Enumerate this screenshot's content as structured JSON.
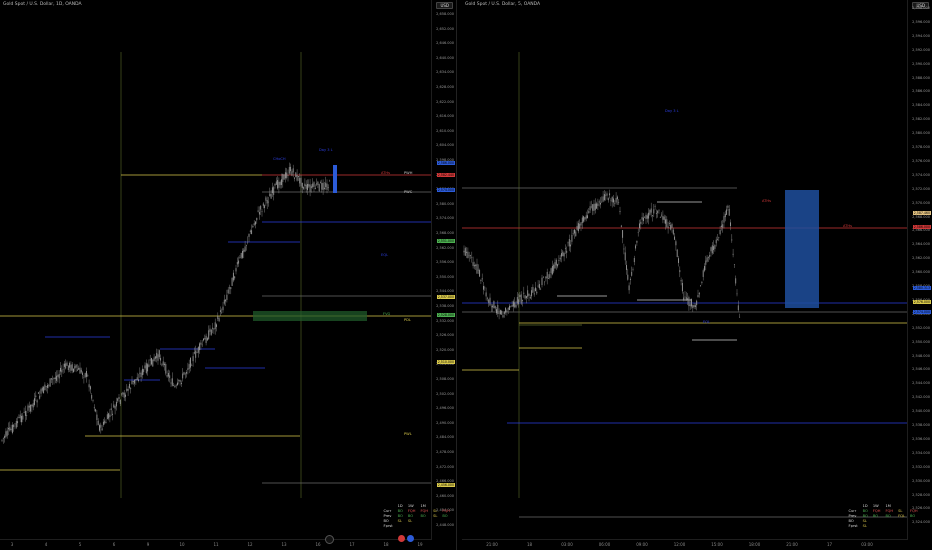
{
  "colors": {
    "background": "#000000",
    "candle": "#9a9a9a",
    "yellow_line": "#d8c84a",
    "olive_line": "#5b6b2b",
    "red_line": "#d03838",
    "blue_line": "#2c3ee0",
    "gray_line": "#888888",
    "green_zone": "#1f5a2a",
    "blue_box": "#1e4f9e"
  },
  "left": {
    "title": "Gold Spot / U.S. Dollar, 1D, OANDA",
    "currency": "USD",
    "price_ticks": [
      "2,658.000",
      "2,652.000",
      "2,646.000",
      "2,640.000",
      "2,634.000",
      "2,628.000",
      "2,622.000",
      "2,616.000",
      "2,610.000",
      "2,604.000",
      "2,598.000",
      "2,592.000",
      "2,586.000",
      "2,580.000",
      "2,574.000",
      "2,568.000",
      "2,562.000",
      "2,556.000",
      "2,550.000",
      "2,544.000",
      "2,538.000",
      "2,532.000",
      "2,526.000",
      "2,520.000",
      "2,514.000",
      "2,508.000",
      "2,502.000",
      "2,496.000",
      "2,490.000",
      "2,484.000",
      "2,478.000",
      "2,472.000",
      "2,466.000",
      "2,460.000",
      "2,454.000",
      "2,448.000"
    ],
    "time_ticks": [
      "3",
      "4",
      "5",
      "6",
      "9",
      "10",
      "11",
      "12",
      "13",
      "16",
      "17",
      "18",
      "19"
    ],
    "chart_labels": [
      {
        "text": "CHoCH",
        "color": "#2c3ee0"
      },
      {
        "text": "Day 3 L",
        "color": "#2c3ee0"
      },
      {
        "text": "ATHs",
        "color": "#d03838"
      },
      {
        "text": "PWH",
        "color": "#cccccc"
      },
      {
        "text": "PWC",
        "color": "#cccccc"
      },
      {
        "text": "PDL",
        "color": "#d8c84a"
      },
      {
        "text": "FVG",
        "color": "#4caf50"
      },
      {
        "text": "EQL",
        "color": "#2c3ee0"
      },
      {
        "text": "PWL",
        "color": "#d8c84a"
      }
    ],
    "price_tags": [
      {
        "text": "2,586.000",
        "bg": "#2c5bd8"
      },
      {
        "text": "2,582.440",
        "bg": "#d03838"
      },
      {
        "text": "2,574.000",
        "bg": "#2c5bd8"
      },
      {
        "text": "2,551.000",
        "bg": "#4caf50"
      },
      {
        "text": "2,537.000",
        "bg": "#d8c84a"
      },
      {
        "text": "2,528.000",
        "bg": "#4caf50"
      },
      {
        "text": "2,510.000",
        "bg": "#d8c84a"
      },
      {
        "text": "2,456.000",
        "bg": "#d8c84a"
      }
    ],
    "info_panel": {
      "headers": [
        "1D",
        "1W",
        "1M"
      ],
      "rows": [
        {
          "label": "Curr",
          "cells": [
            "BO",
            "FQH",
            "FQH",
            "SL",
            "FQH"
          ]
        },
        {
          "label": "Prev",
          "cells": [
            "BO",
            "BO",
            "BO",
            "SL",
            "BO"
          ]
        },
        {
          "label": "BO",
          "cells": [
            "SL",
            "SL",
            "",
            "",
            ""
          ]
        },
        {
          "label": "Fprst",
          "cells": [
            "",
            "",
            "",
            "",
            ""
          ]
        }
      ]
    }
  },
  "right": {
    "title": "Gold Spot / U.S. Dollar, 5, OANDA",
    "currency": "USD",
    "price_ticks": [
      "2,598.000",
      "2,596.000",
      "2,594.000",
      "2,592.000",
      "2,590.000",
      "2,588.000",
      "2,586.000",
      "2,584.000",
      "2,582.000",
      "2,580.000",
      "2,578.000",
      "2,576.000",
      "2,574.000",
      "2,572.000",
      "2,570.000",
      "2,568.000",
      "2,566.000",
      "2,564.000",
      "2,562.000",
      "2,560.000",
      "2,558.000",
      "2,556.000",
      "2,554.000",
      "2,552.000",
      "2,550.000",
      "2,548.000",
      "2,546.000",
      "2,544.000",
      "2,542.000",
      "2,540.000",
      "2,538.000",
      "2,536.000",
      "2,534.000",
      "2,532.000",
      "2,530.000",
      "2,528.000",
      "2,526.000",
      "2,524.000"
    ],
    "time_ticks": [
      "21:00",
      "18",
      "03:00",
      "06:00",
      "09:00",
      "12:00",
      "15:00",
      "18:00",
      "21:00",
      "17",
      "03:00"
    ],
    "chart_labels": [
      {
        "text": "Day 3 L",
        "color": "#2c3ee0"
      },
      {
        "text": "ATHs",
        "color": "#d03838"
      },
      {
        "text": "ATHs",
        "color": "#d03838"
      },
      {
        "text": "EQL",
        "color": "#2c3ee0"
      }
    ],
    "price_tags": [
      {
        "text": "2,587.460",
        "bg": "#e0c080"
      },
      {
        "text": "2,586.000",
        "bg": "#d03838"
      },
      {
        "text": "2,580.313",
        "bg": "#2c5bd8"
      },
      {
        "text": "2,576.000",
        "bg": "#d8c84a"
      },
      {
        "text": "2,574.000",
        "bg": "#2c5bd8"
      }
    ],
    "info_panel": {
      "headers": [
        "1D",
        "1W",
        "1M"
      ],
      "rows": [
        {
          "label": "Curr",
          "cells": [
            "BO",
            "FQH",
            "FQH",
            "SL",
            "FQH"
          ]
        },
        {
          "label": "Prev",
          "cells": [
            "BO",
            "BO",
            "BO",
            "FQL",
            "BO"
          ]
        },
        {
          "label": "BO",
          "cells": [
            "SL",
            "",
            "",
            "",
            ""
          ]
        },
        {
          "label": "Fprst",
          "cells": [
            "SL",
            "",
            "",
            "",
            ""
          ]
        }
      ]
    }
  }
}
